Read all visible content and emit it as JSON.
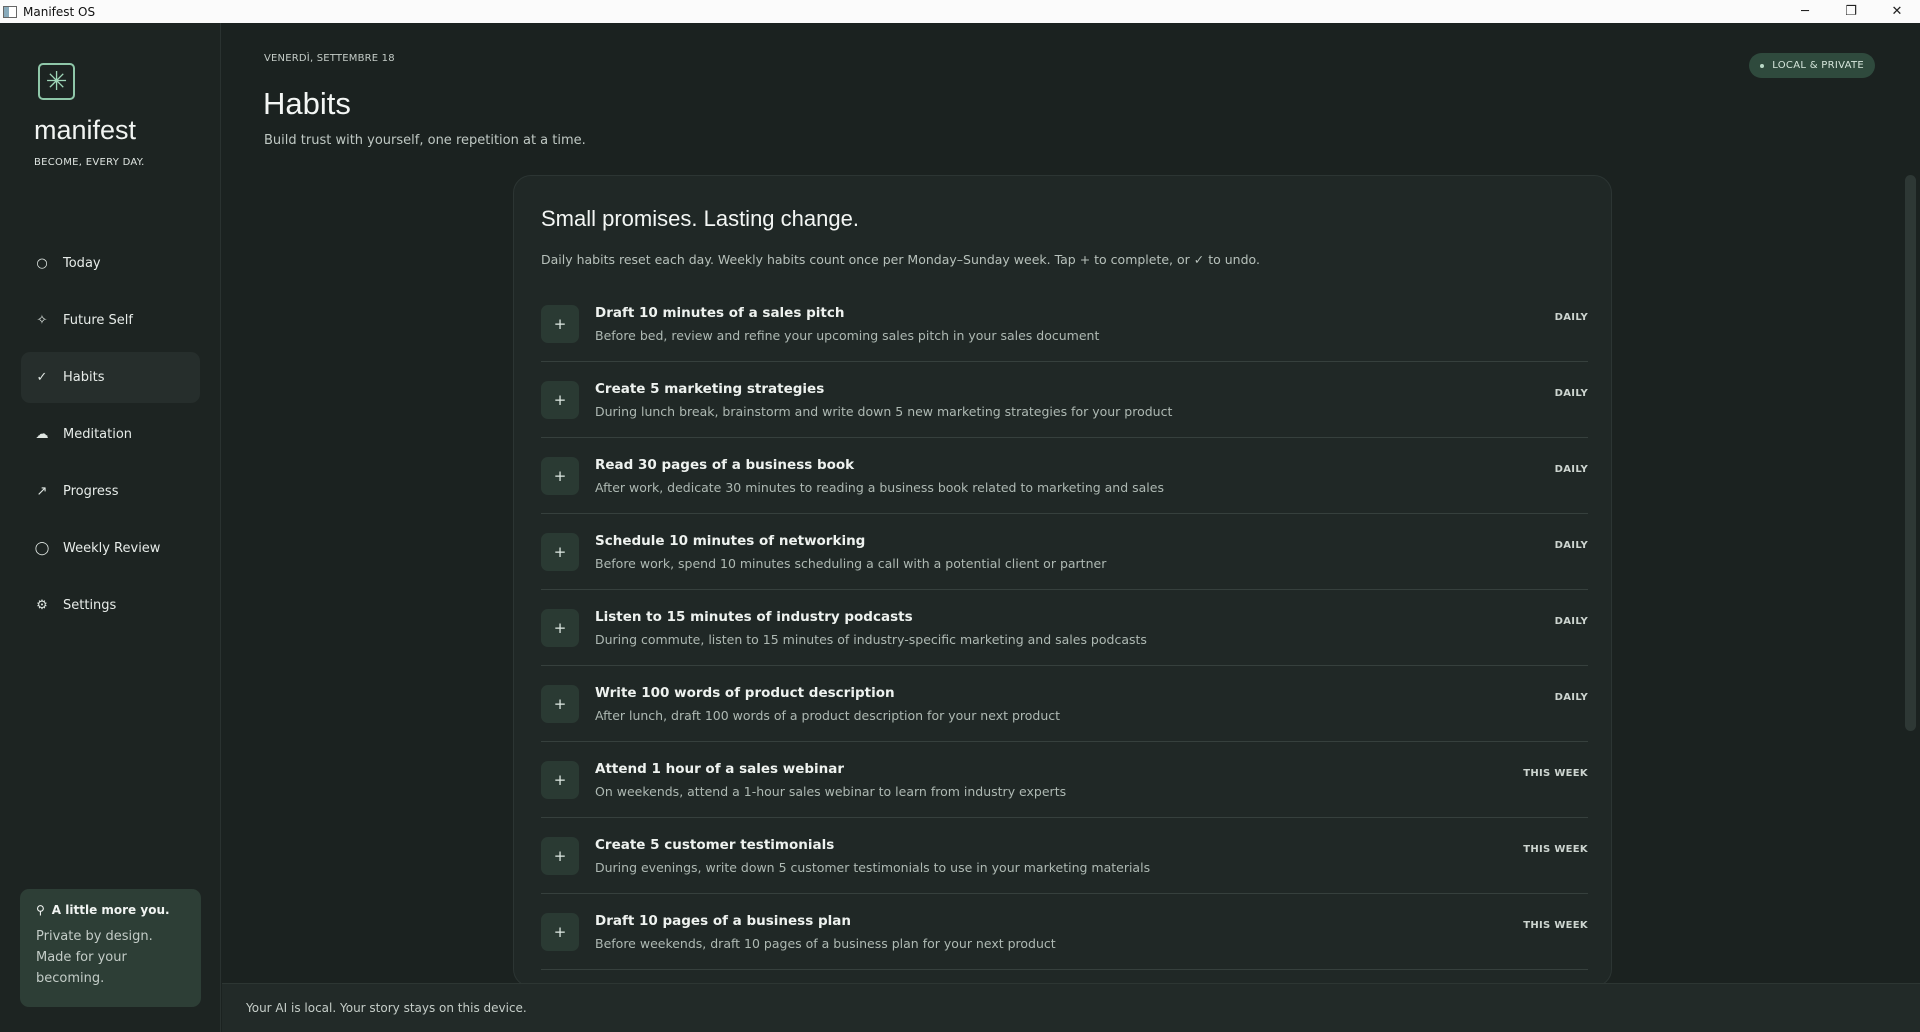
{
  "window": {
    "title": "Manifest OS",
    "minimize": "─",
    "maximize": "❐",
    "close": "✕"
  },
  "sidebar": {
    "brand": "manifest",
    "tagline": "BECOME, EVERY DAY.",
    "logo_icon": "✳",
    "items": [
      {
        "label": "Today",
        "icon": "○",
        "active": false
      },
      {
        "label": "Future Self",
        "icon": "✧",
        "active": false
      },
      {
        "label": "Habits",
        "icon": "✓",
        "active": true
      },
      {
        "label": "Meditation",
        "icon": "☁",
        "active": false
      },
      {
        "label": "Progress",
        "icon": "↗",
        "active": false
      },
      {
        "label": "Weekly Review",
        "icon": "◯",
        "active": false
      },
      {
        "label": "Settings",
        "icon": "⚙",
        "active": false
      }
    ],
    "promo": {
      "icon": "⚲",
      "title": "A little more you.",
      "body": "Private by design. Made for your becoming."
    }
  },
  "header": {
    "date": "VENERDÌ, SETTEMBRE 18",
    "title": "Habits",
    "subtitle": "Build trust with yourself, one repetition at a time.",
    "badge": "LOCAL & PRIVATE"
  },
  "card": {
    "title": "Small promises. Lasting change.",
    "description": "Daily habits reset each day. Weekly habits count once per Monday–Sunday week. Tap + to complete, or ✓ to undo.",
    "add_symbol": "+",
    "habits": [
      {
        "title": "Draft 10 minutes of a sales pitch",
        "desc": "Before bed, review and refine your upcoming sales pitch in your sales document",
        "freq": "DAILY"
      },
      {
        "title": "Create 5 marketing strategies",
        "desc": "During lunch break, brainstorm and write down 5 new marketing strategies for your product",
        "freq": "DAILY"
      },
      {
        "title": "Read 30 pages of a business book",
        "desc": "After work, dedicate 30 minutes to reading a business book related to marketing and sales",
        "freq": "DAILY"
      },
      {
        "title": "Schedule 10 minutes of networking",
        "desc": "Before work, spend 10 minutes scheduling a call with a potential client or partner",
        "freq": "DAILY"
      },
      {
        "title": "Listen to 15 minutes of industry podcasts",
        "desc": "During commute, listen to 15 minutes of industry-specific marketing and sales podcasts",
        "freq": "DAILY"
      },
      {
        "title": "Write 100 words of product description",
        "desc": "After lunch, draft 100 words of a product description for your next product",
        "freq": "DAILY"
      },
      {
        "title": "Attend 1 hour of a sales webinar",
        "desc": "On weekends, attend a 1-hour sales webinar to learn from industry experts",
        "freq": "THIS WEEK"
      },
      {
        "title": "Create 5 customer testimonials",
        "desc": "During evenings, write down 5 customer testimonials to use in your marketing materials",
        "freq": "THIS WEEK"
      },
      {
        "title": "Draft 10 pages of a business plan",
        "desc": "Before weekends, draft 10 pages of a business plan for your next product",
        "freq": "THIS WEEK"
      }
    ]
  },
  "footer": {
    "text": "Your AI is local. Your story stays on this device."
  }
}
